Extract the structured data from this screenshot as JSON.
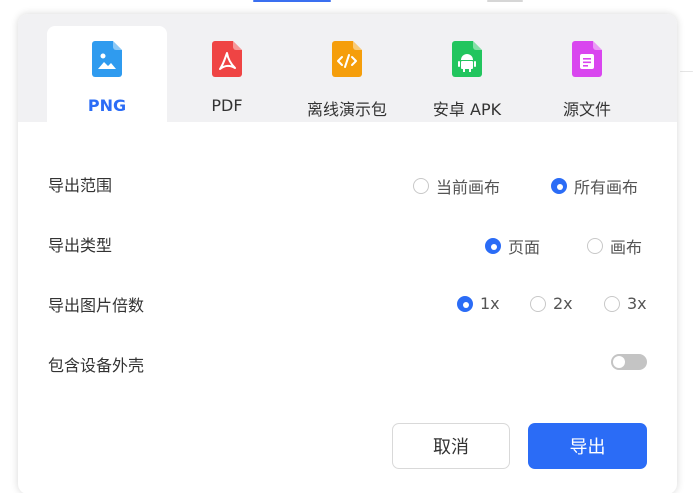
{
  "tabs": [
    {
      "label": "PNG",
      "icon": "image-file-icon",
      "color": "#2f9bef",
      "active": true
    },
    {
      "label": "PDF",
      "icon": "pdf-file-icon",
      "color": "#ef4444",
      "active": false
    },
    {
      "label": "离线演示包",
      "icon": "code-file-icon",
      "color": "#f59e0b",
      "active": false
    },
    {
      "label": "安卓 APK",
      "icon": "android-file-icon",
      "color": "#22c55e",
      "active": false
    },
    {
      "label": "源文件",
      "icon": "document-file-icon",
      "color": "#d946ef",
      "active": false
    }
  ],
  "rows": {
    "range": {
      "label": "导出范围",
      "options": [
        {
          "label": "当前画布",
          "checked": false
        },
        {
          "label": "所有画布",
          "checked": true
        }
      ]
    },
    "type": {
      "label": "导出类型",
      "options": [
        {
          "label": "页面",
          "checked": true
        },
        {
          "label": "画布",
          "checked": false
        }
      ]
    },
    "scale": {
      "label": "导出图片倍数",
      "options": [
        {
          "label": "1x",
          "checked": true
        },
        {
          "label": "2x",
          "checked": false
        },
        {
          "label": "3x",
          "checked": false
        }
      ]
    },
    "device": {
      "label": "包含设备外壳",
      "enabled": false
    }
  },
  "buttons": {
    "cancel": "取消",
    "export": "导出"
  },
  "colors": {
    "accent": "#2b6cf6",
    "tabbar_bg": "#f1f1f3"
  }
}
